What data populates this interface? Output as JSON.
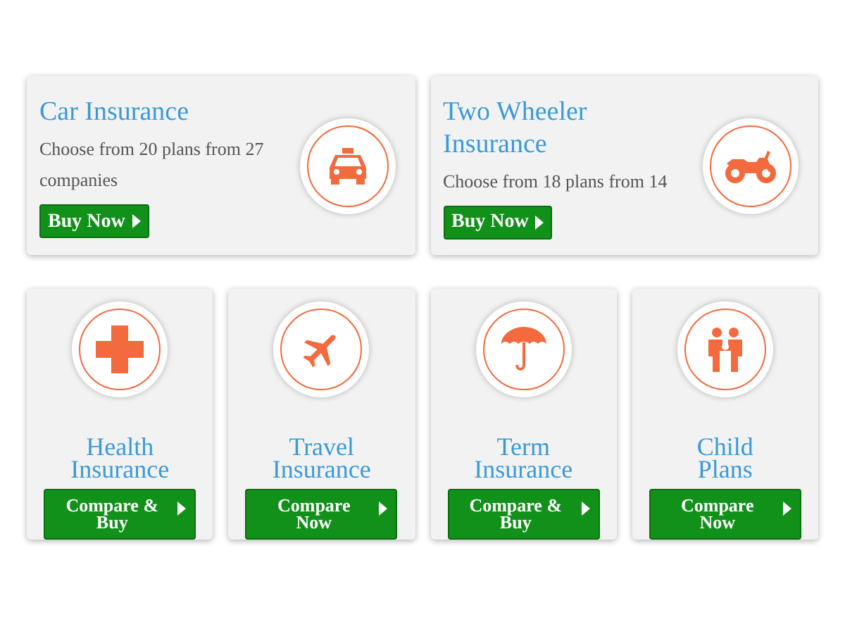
{
  "featured": [
    {
      "title": "Car Insurance",
      "description": "Choose from 20 plans from 27 companies",
      "button": "Buy Now"
    },
    {
      "title": "Two Wheeler Insurance",
      "description": "Choose from 18 plans from 14",
      "button": "Buy Now"
    }
  ],
  "products": [
    {
      "title": "Health Insurance",
      "button": "Compare & Buy"
    },
    {
      "title": "Travel Insurance",
      "button": "Compare Now"
    },
    {
      "title": "Term Insurance",
      "button": "Compare & Buy"
    },
    {
      "title": "Child Plans",
      "button": "Compare Now"
    }
  ]
}
